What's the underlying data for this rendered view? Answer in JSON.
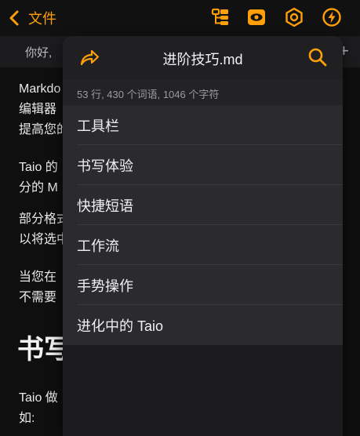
{
  "nav": {
    "back_label": "文件"
  },
  "tabbar": {
    "tab_text": "你好,",
    "add_symbol": "+"
  },
  "editor": {
    "lines": [
      "Markdo",
      "编辑器",
      "提高您的",
      "Taio 的",
      "分的 M",
      "部分格式",
      "以将选中",
      "当您在",
      "不需要",
      "书写",
      "Taio 做",
      "如:"
    ]
  },
  "panel": {
    "title": "进阶技巧.md",
    "stats": "53 行, 430 个词语, 1046 个字符",
    "items": [
      {
        "label": "工具栏"
      },
      {
        "label": "书写体验"
      },
      {
        "label": "快捷短语"
      },
      {
        "label": "工作流"
      },
      {
        "label": "手势操作"
      },
      {
        "label": "进化中的 Taio"
      }
    ]
  },
  "colors": {
    "accent": "#ff9f0a",
    "background": "#0f0f10",
    "panel": "#1b1b1d",
    "menu_item": "#2b2b2e"
  },
  "icons": [
    "chevron-left-icon",
    "outline-icon",
    "preview-eye-icon",
    "settings-hexagon-icon",
    "action-bolt-icon",
    "share-icon",
    "search-icon"
  ]
}
